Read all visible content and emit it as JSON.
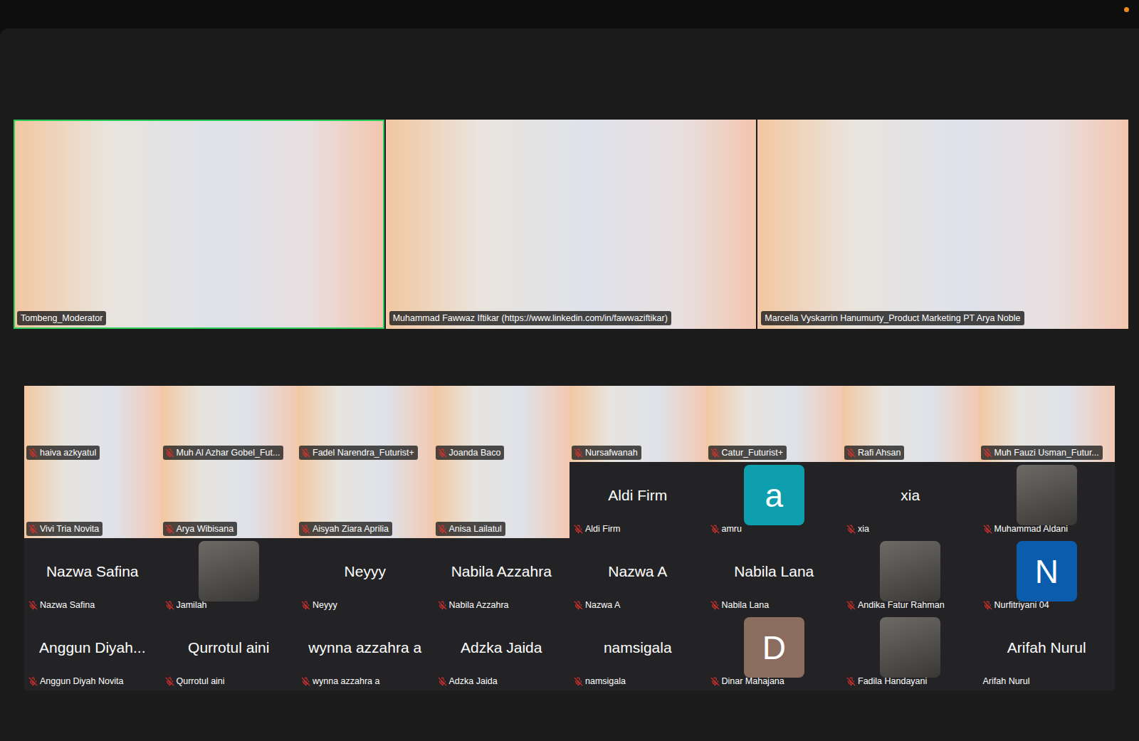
{
  "speakers": [
    {
      "name": "Tombeng_Moderator",
      "active": true
    },
    {
      "name": "Muhammad Fawwaz Iftikar (https://www.linkedin.com/in/fawwaziftikar)",
      "active": false
    },
    {
      "name": "Marcella Vyskarrin Hanumurty_Product Marketing PT Arya Noble",
      "active": false
    }
  ],
  "participants": [
    {
      "name": "haiva azkyatul",
      "kind": "video",
      "muted": true
    },
    {
      "name": "Muh Al Azhar Gobel_Fut...",
      "kind": "video",
      "muted": true
    },
    {
      "name": "Fadel Narendra_Futurist+",
      "kind": "video",
      "muted": true
    },
    {
      "name": "Joanda Baco",
      "kind": "video",
      "muted": true
    },
    {
      "name": "Nursafwanah",
      "kind": "video",
      "muted": true
    },
    {
      "name": "Catur_Futurist+",
      "kind": "video",
      "muted": true
    },
    {
      "name": "Rafi Ahsan",
      "kind": "video",
      "muted": true
    },
    {
      "name": "Muh Fauzi Usman_Futur...",
      "kind": "video",
      "muted": true
    },
    {
      "name": "Vivi Tria Novita",
      "kind": "video",
      "muted": true
    },
    {
      "name": "Arya Wibisana",
      "kind": "video",
      "muted": true
    },
    {
      "name": "Aisyah Ziara Aprilia",
      "kind": "video",
      "muted": true
    },
    {
      "name": "Anisa Lailatul",
      "kind": "video",
      "muted": true
    },
    {
      "name": "Aldi Firm",
      "kind": "name",
      "display": "Aldi Firm",
      "muted": true
    },
    {
      "name": "amru",
      "kind": "avatar",
      "letter": "a",
      "color": "#0e9fae",
      "muted": true
    },
    {
      "name": "xia",
      "kind": "name",
      "display": "xia",
      "muted": true
    },
    {
      "name": "Muhammad Aldani",
      "kind": "photo",
      "muted": true
    },
    {
      "name": "Nazwa Safina",
      "kind": "name",
      "display": "Nazwa Safina",
      "muted": true
    },
    {
      "name": "Jamilah",
      "kind": "photo",
      "muted": true
    },
    {
      "name": "Neyyy",
      "kind": "name",
      "display": "Neyyy",
      "muted": true
    },
    {
      "name": "Nabila Azzahra",
      "kind": "name",
      "display": "Nabila Azzahra",
      "muted": true
    },
    {
      "name": "Nazwa A",
      "kind": "name",
      "display": "Nazwa A",
      "muted": true
    },
    {
      "name": "Nabila Lana",
      "kind": "name",
      "display": "Nabila Lana",
      "muted": true
    },
    {
      "name": "Andika Fatur Rahman",
      "kind": "photo",
      "muted": true
    },
    {
      "name": "Nurfitriyani 04",
      "kind": "avatar",
      "letter": "N",
      "color": "#0b5cad",
      "muted": true
    },
    {
      "name": "Anggun Diyah Novita",
      "kind": "name",
      "display": "Anggun Diyah...",
      "muted": true
    },
    {
      "name": "Qurrotul aini",
      "kind": "name",
      "display": "Qurrotul aini",
      "muted": true
    },
    {
      "name": "wynna azzahra a",
      "kind": "name",
      "display": "wynna azzahra a",
      "muted": true
    },
    {
      "name": "Adzka Jaida",
      "kind": "name",
      "display": "Adzka Jaida",
      "muted": true
    },
    {
      "name": "namsigala",
      "kind": "name",
      "display": "namsigala",
      "muted": true
    },
    {
      "name": "Dinar Mahajana",
      "kind": "avatar",
      "letter": "D",
      "color": "#8b6d5f",
      "muted": true
    },
    {
      "name": "Fadila Handayani",
      "kind": "photo",
      "muted": true
    },
    {
      "name": "Arifah Nurul",
      "kind": "name",
      "display": "Arifah Nurul",
      "muted": false
    }
  ]
}
